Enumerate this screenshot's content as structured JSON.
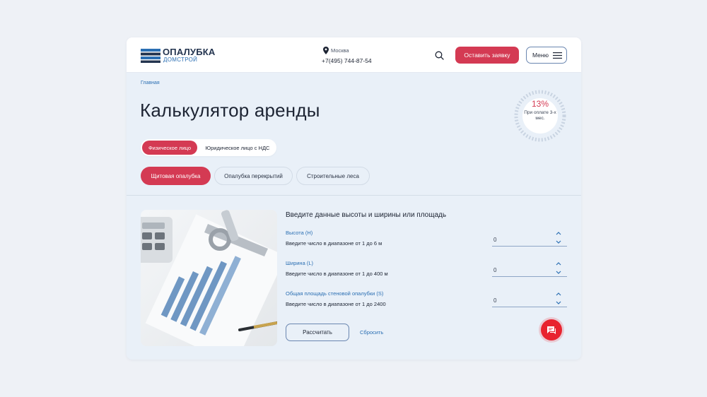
{
  "header": {
    "logo_line1": "ОПАЛУБКА",
    "logo_line2": "ДОМСТРОЙ",
    "city": "Москва",
    "phone": "+7(495) 744-87-54",
    "order_label": "Оставить заявку",
    "menu_label": "Меню"
  },
  "breadcrumb": "Главная",
  "page_title": "Калькулятор аренды",
  "badge": {
    "percent": "13%",
    "text": "При оплате 3-х мес."
  },
  "entity_toggle": {
    "individual": "Физическое лицо",
    "legal": "Юридическое лицо с НДС"
  },
  "categories": [
    "Щитовая опалубка",
    "Опалубка перекрытий",
    "Строительные леса"
  ],
  "form": {
    "title": "Введите данные высоты и ширины или площадь",
    "fields": [
      {
        "label": "Высота (H)",
        "hint": "Введите число в диапазоне от 1 до 6 м",
        "value": "0"
      },
      {
        "label": "Ширина (L)",
        "hint": "Введите число в диапазоне от 1 до 400 м",
        "value": "0"
      },
      {
        "label": "Общая площадь стеновой опалубки (S)",
        "hint": "Введите число в диапазоне от 1 до 2400",
        "value": "0"
      }
    ],
    "calculate_label": "Рассчитать",
    "reset_label": "Сбросить"
  },
  "colors": {
    "accent": "#d43a53",
    "link": "#2b6fb3",
    "chat": "#e8232f"
  },
  "icons": [
    "pin-icon",
    "search-icon",
    "menu-icon",
    "arrow-up-icon",
    "arrow-down-icon",
    "chat-icon"
  ]
}
